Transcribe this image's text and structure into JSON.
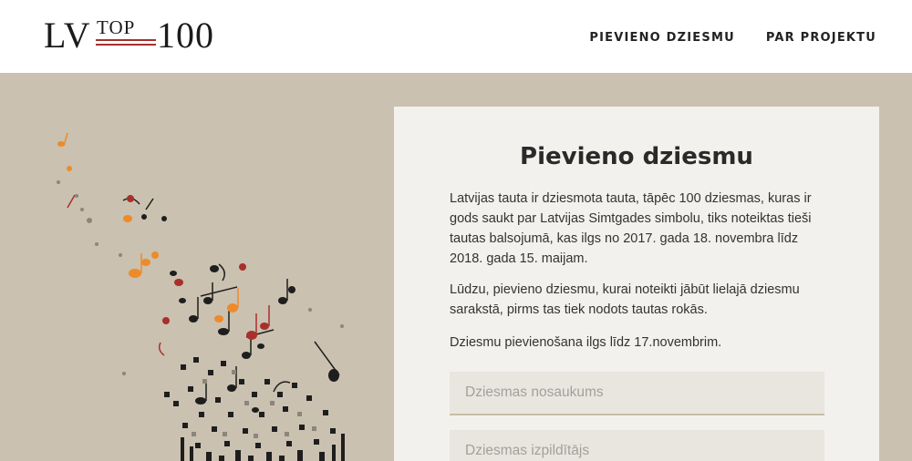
{
  "logo": {
    "lv": "LV",
    "top": "TOP",
    "hundred": "100"
  },
  "nav": {
    "add_song": "PIEVIENO DZIESMU",
    "about": "PAR PROJEKTU"
  },
  "form": {
    "title": "Pievieno dziesmu",
    "intro": "Latvijas tauta ir dziesmota tauta, tāpēc 100 dziesmas, kuras ir gods saukt par Latvijas Simtgades simbolu, tiks noteiktas tieši tautas balsojumā, kas ilgs no 2017. gada 18. novembra līdz 2018. gada 15. maijam.",
    "request": "Lūdzu, pievieno dziesmu, kurai noteikti jābūt lielajā dziesmu sarakstā, pirms tas tiek nodots tautas rokās.",
    "deadline": "Dziesmu pievienošana ilgs līdz 17.novembrim.",
    "song_title_placeholder": "Dziesmas nosaukums",
    "artist_placeholder": "Dziesmas izpildītājs"
  },
  "colors": {
    "background": "#cac1b0",
    "card": "#f3f1ed",
    "accent_red": "#a8302c",
    "accent_orange": "#ef8a2a"
  }
}
